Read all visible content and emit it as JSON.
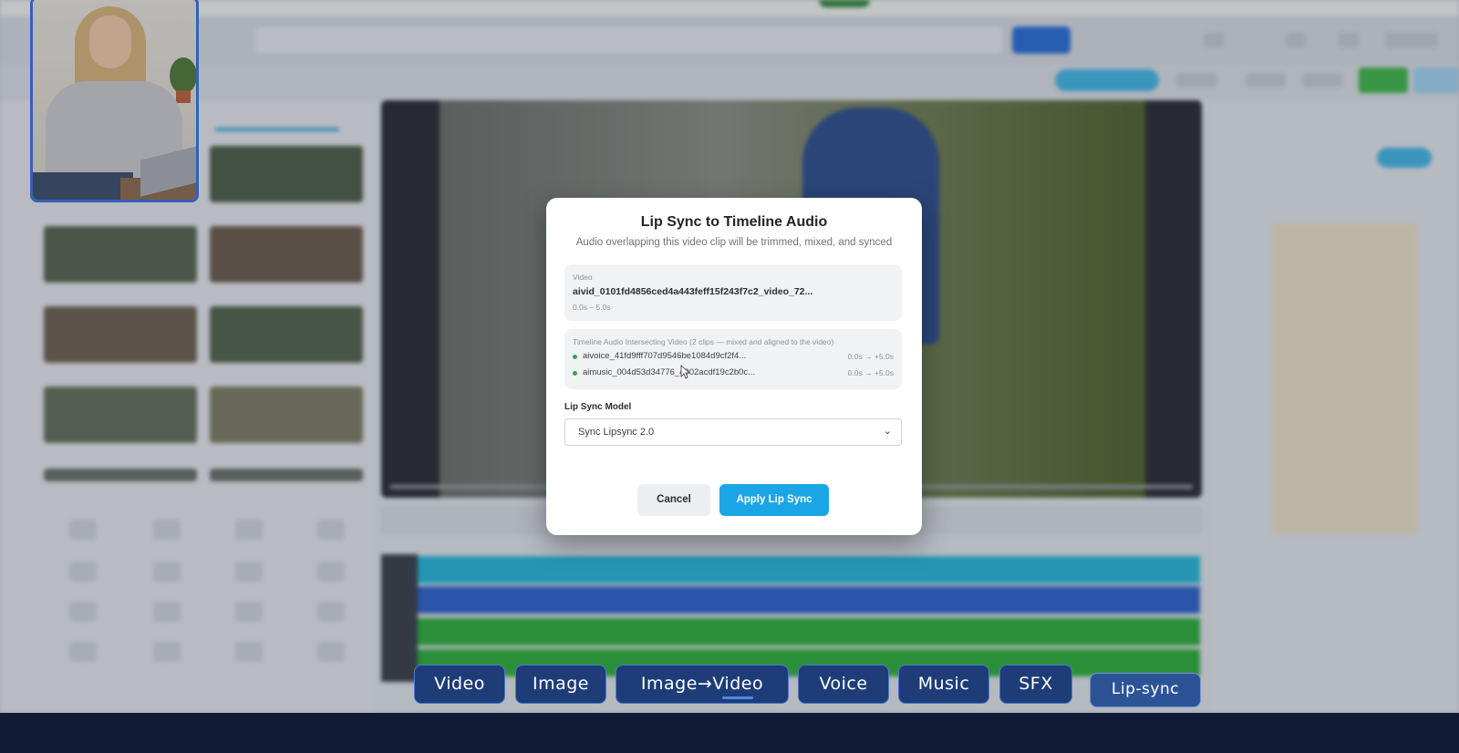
{
  "modal": {
    "title": "Lip Sync to Timeline Audio",
    "subtitle": "Audio overlapping this video clip will be trimmed, mixed, and synced",
    "video_card": {
      "label": "Video",
      "filename": "aivid_0101fd4856ced4a443feff15f243f7c2_video_72...",
      "range": "0.0s – 5.0s"
    },
    "audio_card": {
      "label": "Timeline Audio Intersecting Video (2 clips — mixed and aligned to the video)",
      "clips": [
        {
          "name": "aivoice_41fd9fff707d9546be1084d9cf2f4...",
          "range": "0.0s → +5.0s"
        },
        {
          "name": "aimusic_004d53d34776_4902acdf19c2b0c...",
          "range": "0.0s → +5.0s"
        }
      ]
    },
    "model_label": "Lip Sync Model",
    "model_value": "Sync Lipsync 2.0",
    "cancel_label": "Cancel",
    "apply_label": "Apply Lip Sync"
  },
  "badges": [
    "Video",
    "Image",
    "Image→Video",
    "Voice",
    "Music",
    "SFX",
    "Lip-sync"
  ],
  "colors": {
    "accent": "#1aa6e6",
    "badge_bg": "#1e3d78",
    "badge_border": "#4b79c9",
    "footer": "#0f1b34"
  }
}
